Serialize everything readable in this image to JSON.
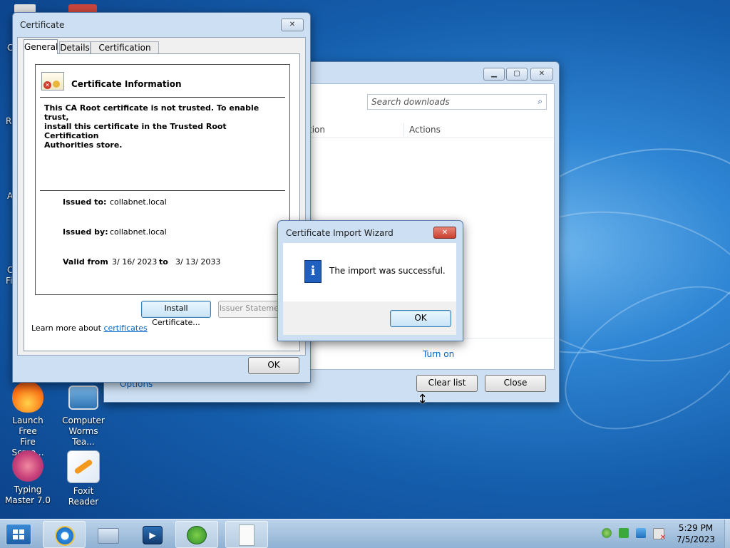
{
  "desktop": {
    "icons": [
      {
        "label_line1": "Launch Free",
        "label_line2": "Fire Scree..."
      },
      {
        "label_line1": "Computer",
        "label_line2": "Worms Tea..."
      },
      {
        "label_line1": "Typing",
        "label_line2": "Master 7.0"
      },
      {
        "label_line1": "Foxit Reader",
        "label_line2": ""
      }
    ],
    "edge_letters": [
      "C",
      "R",
      "A",
      "C",
      "Fi"
    ]
  },
  "downloads_window": {
    "search_placeholder": "Search downloads",
    "columns": [
      "tion",
      "Actions"
    ],
    "turn_on_link": "Turn on",
    "options_link": "Options",
    "clear_list_label": "Clear list",
    "close_label": "Close"
  },
  "certificate_window": {
    "title": "Certificate",
    "tabs": [
      "General",
      "Details",
      "Certification Path"
    ],
    "info_heading": "Certificate Information",
    "warning_lines": [
      "This CA Root certificate is not trusted. To enable trust,",
      "install this certificate in the Trusted Root Certification",
      "Authorities store."
    ],
    "issued_to_label": "Issued to:",
    "issued_to_value": "collabnet.local",
    "issued_by_label": "Issued by:",
    "issued_by_value": "collabnet.local",
    "valid_from_label": "Valid from",
    "valid_from_value": "3/ 16/ 2023",
    "valid_to_label": "to",
    "valid_to_value": "3/ 13/ 2033",
    "install_button": "Install Certificate...",
    "issuer_statement_button": "Issuer Statement",
    "learn_more_text": "Learn more about",
    "learn_more_link": "certificates",
    "ok_button": "OK"
  },
  "wizard_dialog": {
    "title": "Certificate Import Wizard",
    "message": "The import was successful.",
    "ok_button": "OK",
    "info_glyph": "i"
  },
  "taskbar": {
    "time": "5:29 PM",
    "date": "7/5/2023",
    "pinned": [
      "internet-explorer",
      "file-explorer",
      "media-player",
      "download-manager",
      "notepad"
    ]
  },
  "colors": {
    "accent_link": "#0066cc",
    "close_red": "#c9463d",
    "info_blue": "#1f5fbf"
  }
}
